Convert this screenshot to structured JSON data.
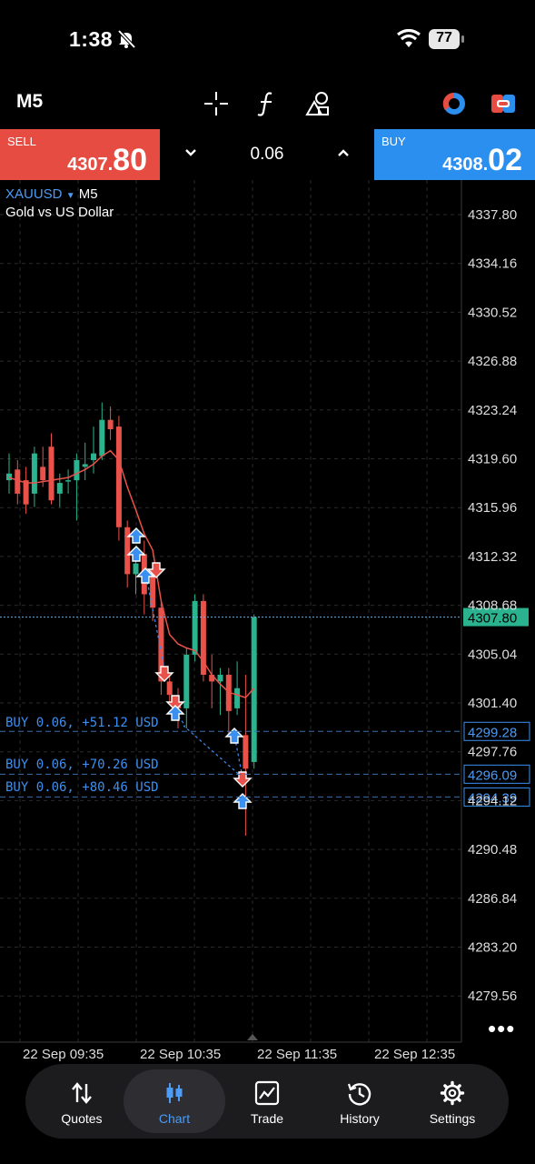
{
  "status_bar": {
    "time": "1:38",
    "battery": "77"
  },
  "toolbar": {
    "timeframe": "M5"
  },
  "trade": {
    "sell_label": "SELL",
    "sell_price_main": "4307.",
    "sell_price_big": "80",
    "lot": "0.06",
    "buy_label": "BUY",
    "buy_price_main": "4308.",
    "buy_price_big": "02"
  },
  "chart": {
    "symbol": "XAUUSD",
    "timeframe": "M5",
    "description": "Gold vs US Dollar",
    "price_labels": [
      "4337.80",
      "4334.16",
      "4330.52",
      "4326.88",
      "4323.24",
      "4319.60",
      "4315.96",
      "4312.32",
      "4308.68",
      "4305.04",
      "4301.40",
      "4297.76",
      "4294.12",
      "4290.48",
      "4286.84",
      "4283.20",
      "4279.56"
    ],
    "time_labels": [
      "22 Sep 09:35",
      "22 Sep 10:35",
      "22 Sep 11:35",
      "22 Sep 12:35"
    ],
    "current_price": "4307.80",
    "positions": [
      {
        "label": "BUY 0.06, +51.12 USD",
        "price": "4299.28"
      },
      {
        "label": "BUY 0.06, +70.26 USD",
        "price": "4296.09"
      },
      {
        "label": "BUY 0.06, +80.46 USD",
        "price": "4294.39"
      }
    ],
    "candles": [
      {
        "o": 4318.0,
        "h": 4320.0,
        "l": 4317.0,
        "c": 4318.5
      },
      {
        "o": 4318.8,
        "h": 4319.5,
        "l": 4316.2,
        "c": 4317.0
      },
      {
        "o": 4318.0,
        "h": 4319.0,
        "l": 4315.5,
        "c": 4316.2
      },
      {
        "o": 4317.0,
        "h": 4320.5,
        "l": 4316.0,
        "c": 4320.0
      },
      {
        "o": 4319.0,
        "h": 4320.5,
        "l": 4317.5,
        "c": 4318.0
      },
      {
        "o": 4320.5,
        "h": 4321.5,
        "l": 4316.2,
        "c": 4316.5
      },
      {
        "o": 4317.0,
        "h": 4318.5,
        "l": 4316.0,
        "c": 4317.8
      },
      {
        "o": 4318.0,
        "h": 4318.8,
        "l": 4317.0,
        "c": 4318.0
      },
      {
        "o": 4318.0,
        "h": 4320.0,
        "l": 4315.0,
        "c": 4319.5
      },
      {
        "o": 4319.0,
        "h": 4320.8,
        "l": 4318.0,
        "c": 4319.2
      },
      {
        "o": 4319.5,
        "h": 4322.0,
        "l": 4318.5,
        "c": 4320.0
      },
      {
        "o": 4319.8,
        "h": 4323.8,
        "l": 4319.5,
        "c": 4322.5
      },
      {
        "o": 4322.5,
        "h": 4323.5,
        "l": 4321.0,
        "c": 4321.8
      },
      {
        "o": 4322.0,
        "h": 4322.8,
        "l": 4313.5,
        "c": 4314.5
      },
      {
        "o": 4314.5,
        "h": 4315.0,
        "l": 4310.0,
        "c": 4311.0
      },
      {
        "o": 4311.0,
        "h": 4312.5,
        "l": 4309.5,
        "c": 4311.8
      },
      {
        "o": 4312.5,
        "h": 4313.5,
        "l": 4308.0,
        "c": 4309.5
      },
      {
        "o": 4311.0,
        "h": 4311.8,
        "l": 4307.5,
        "c": 4308.5
      },
      {
        "o": 4308.5,
        "h": 4309.0,
        "l": 4302.0,
        "c": 4303.0
      },
      {
        "o": 4303.0,
        "h": 4303.5,
        "l": 4301.5,
        "c": 4302.0
      },
      {
        "o": 4301.5,
        "h": 4302.5,
        "l": 4299.5,
        "c": 4301.0
      },
      {
        "o": 4301.0,
        "h": 4305.5,
        "l": 4299.5,
        "c": 4305.0
      },
      {
        "o": 4305.0,
        "h": 4309.5,
        "l": 4304.5,
        "c": 4309.0
      },
      {
        "o": 4309.0,
        "h": 4309.5,
        "l": 4303.0,
        "c": 4303.5
      },
      {
        "o": 4303.5,
        "h": 4305.0,
        "l": 4301.0,
        "c": 4303.0
      },
      {
        "o": 4303.0,
        "h": 4304.0,
        "l": 4300.5,
        "c": 4303.5
      },
      {
        "o": 4303.5,
        "h": 4304.0,
        "l": 4299.0,
        "c": 4300.8
      },
      {
        "o": 4301.0,
        "h": 4304.5,
        "l": 4300.5,
        "c": 4302.5
      },
      {
        "o": 4299.0,
        "h": 4303.5,
        "l": 4291.5,
        "c": 4296.5
      },
      {
        "o": 4297.0,
        "h": 4308.0,
        "l": 4296.5,
        "c": 4307.8
      }
    ],
    "ma": [
      4318.2,
      4318.0,
      4317.8,
      4317.8,
      4317.9,
      4318.0,
      4318.1,
      4318.2,
      4318.5,
      4318.8,
      4319.2,
      4319.8,
      4320.2,
      4319.5,
      4317.5,
      4315.8,
      4314.0,
      4312.8,
      4309.0,
      4306.5,
      4305.8,
      4305.5,
      4305.3,
      4304.5,
      4303.5,
      4302.8,
      4302.2,
      4302.0,
      4301.8,
      4302.5
    ],
    "colors": {
      "bull": "#2bb38f",
      "bear": "#e8524a",
      "ma": "#e8524a",
      "trade_line": "#3b8ff0",
      "grid": "#2a2a2a"
    }
  },
  "nav": {
    "items": [
      {
        "label": "Quotes",
        "icon": "quotes-icon"
      },
      {
        "label": "Chart",
        "icon": "chart-icon"
      },
      {
        "label": "Trade",
        "icon": "trade-icon"
      },
      {
        "label": "History",
        "icon": "history-icon"
      },
      {
        "label": "Settings",
        "icon": "settings-icon"
      }
    ]
  }
}
